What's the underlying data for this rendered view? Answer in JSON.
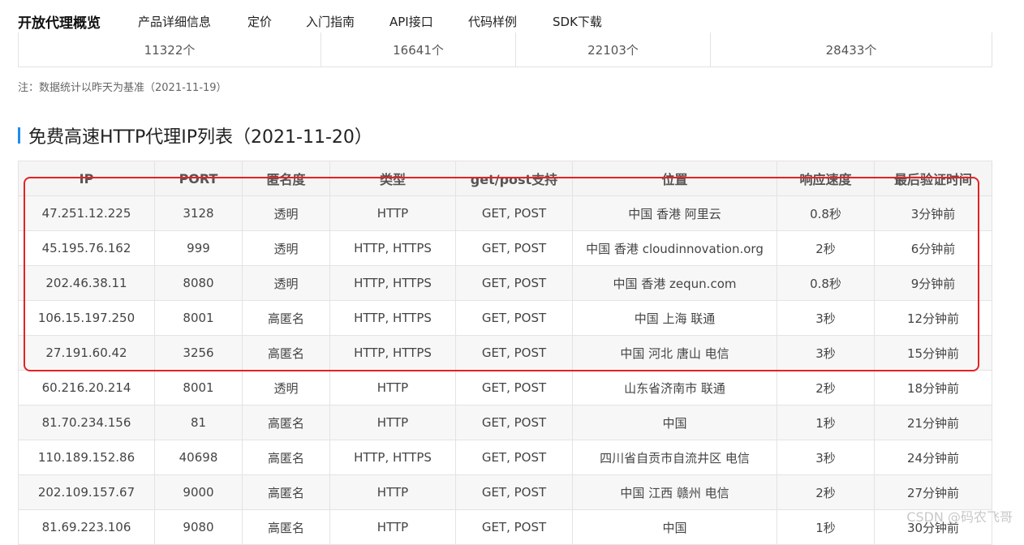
{
  "nav": {
    "brand": "开放代理概览",
    "items": [
      "产品详细信息",
      "定价",
      "入门指南",
      "API接口",
      "代码样例",
      "SDK下载"
    ]
  },
  "stats": [
    "11322个",
    "16641个",
    "22103个",
    "28433个"
  ],
  "note": "注：数据统计以昨天为基准（2021-11-19）",
  "section_title": "免费高速HTTP代理IP列表（2021-11-20）",
  "table": {
    "headers": [
      "IP",
      "PORT",
      "匿名度",
      "类型",
      "get/post支持",
      "位置",
      "响应速度",
      "最后验证时间"
    ],
    "rows": [
      [
        "47.251.12.225",
        "3128",
        "透明",
        "HTTP",
        "GET, POST",
        "中国 香港 阿里云",
        "0.8秒",
        "3分钟前"
      ],
      [
        "45.195.76.162",
        "999",
        "透明",
        "HTTP, HTTPS",
        "GET, POST",
        "中国 香港 cloudinnovation.org",
        "2秒",
        "6分钟前"
      ],
      [
        "202.46.38.11",
        "8080",
        "透明",
        "HTTP, HTTPS",
        "GET, POST",
        "中国 香港 zequn.com",
        "0.8秒",
        "9分钟前"
      ],
      [
        "106.15.197.250",
        "8001",
        "高匿名",
        "HTTP, HTTPS",
        "GET, POST",
        "中国 上海 联通",
        "3秒",
        "12分钟前"
      ],
      [
        "27.191.60.42",
        "3256",
        "高匿名",
        "HTTP, HTTPS",
        "GET, POST",
        "中国 河北 唐山 电信",
        "3秒",
        "15分钟前"
      ],
      [
        "60.216.20.214",
        "8001",
        "透明",
        "HTTP",
        "GET, POST",
        "山东省济南市 联通",
        "2秒",
        "18分钟前"
      ],
      [
        "81.70.234.156",
        "81",
        "高匿名",
        "HTTP",
        "GET, POST",
        "中国",
        "1秒",
        "21分钟前"
      ],
      [
        "110.189.152.86",
        "40698",
        "高匿名",
        "HTTP, HTTPS",
        "GET, POST",
        "四川省自贡市自流井区 电信",
        "3秒",
        "24分钟前"
      ],
      [
        "202.109.157.67",
        "9000",
        "高匿名",
        "HTTP",
        "GET, POST",
        "中国 江西 赣州 电信",
        "2秒",
        "27分钟前"
      ],
      [
        "81.69.223.106",
        "9080",
        "高匿名",
        "HTTP",
        "GET, POST",
        "中国",
        "1秒",
        "30分钟前"
      ]
    ]
  },
  "watermark": "CSDN @码农飞哥",
  "colors": {
    "accent": "#1f8ceb",
    "highlight": "#e52222"
  }
}
